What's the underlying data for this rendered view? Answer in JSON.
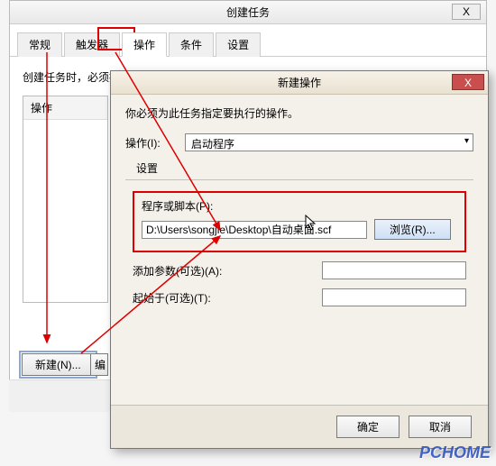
{
  "parent": {
    "title": "创建任务",
    "close_glyph": "X",
    "tabs": [
      "常规",
      "触发器",
      "操作",
      "条件",
      "设置"
    ],
    "active_tab_index": 2,
    "hint": "创建任务时，必须指定任务启动时发生的操作。",
    "list_header": "操作",
    "new_btn": "新建(N)...",
    "edit_btn_partial": "编"
  },
  "dialog": {
    "title": "新建操作",
    "close_glyph": "X",
    "hint": "你必须为此任务指定要执行的操作。",
    "action_label": "操作(I):",
    "action_value": "启动程序",
    "settings_label": "设置",
    "program_label": "程序或脚本(P):",
    "program_value": "D:\\Users\\songjie\\Desktop\\自动桌面.scf",
    "browse_btn": "浏览(R)...",
    "args_label": "添加参数(可选)(A):",
    "args_value": "",
    "startin_label": "起始于(可选)(T):",
    "startin_value": "",
    "ok_btn": "确定",
    "cancel_btn": "取消"
  },
  "cursor_glyph": "↖",
  "watermark": "PCHOME"
}
